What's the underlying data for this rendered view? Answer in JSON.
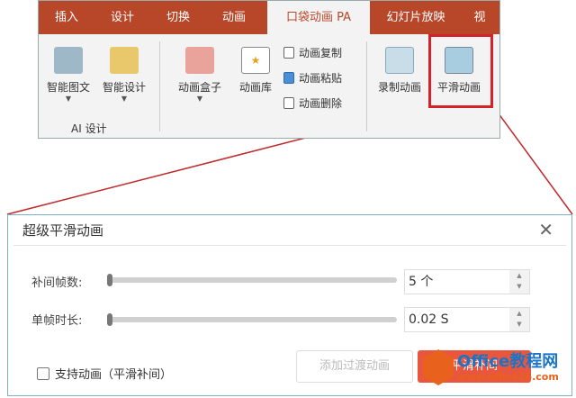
{
  "ribbon": {
    "tabs": [
      "插入",
      "设计",
      "切换",
      "动画",
      "口袋动画 PA",
      "幻灯片放映",
      "视"
    ],
    "buttons": {
      "smart_graphic": "智能图文",
      "smart_design": "智能设计",
      "anim_box": "动画盒子",
      "anim_lib": "动画库",
      "copy": "动画复制",
      "paste": "动画粘贴",
      "delete": "动画删除",
      "record": "录制动画",
      "smooth": "平滑动画"
    },
    "group_ai": "AI 设计"
  },
  "dialog": {
    "title": "超级平滑动画",
    "frames_label": "补间帧数:",
    "frames_value": "5 个",
    "duration_label": "单帧时长:",
    "duration_value": "0.02 S",
    "checkbox_label": "支持动画（平滑补间）",
    "add_transition": "添加过渡动画",
    "primary": "平滑补间"
  },
  "watermark": {
    "name": "Office教程网",
    "url": "www.office26.com"
  },
  "colors": {
    "tab_bar": "#b8472a",
    "highlight": "#d6202a",
    "primary": "#e8563e"
  }
}
